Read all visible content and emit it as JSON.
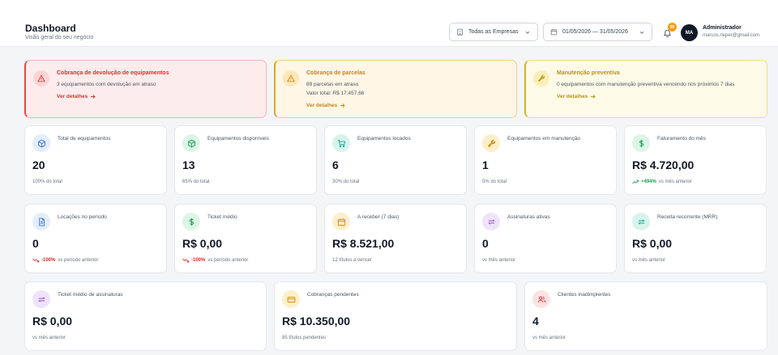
{
  "header": {
    "title": "Dashboard",
    "subtitle": "Visão geral do seu negócio",
    "company_filter": "Todas as Empresas",
    "date_range": "01/05/2026 — 31/05/2026",
    "notifications_count": "95",
    "user": {
      "initials": "MA",
      "name": "Administrador",
      "email": "marcos.rieper@gmail.com"
    }
  },
  "alerts": [
    {
      "title": "Cobrança de devolução de equipamentos",
      "lines": [
        "3 equipamentos com devolução em atraso"
      ],
      "link": "Ver detalhes",
      "icon": "warning-triangle-icon"
    },
    {
      "title": "Cobrança de parcelas",
      "lines": [
        "89 parcelas em atraso",
        "Valor total: R$ 17.457,66"
      ],
      "link": "Ver detalhes",
      "icon": "warning-triangle-icon"
    },
    {
      "title": "Manutenção preventiva",
      "lines": [
        "0 equipamentos com manutenção preventiva vencendo nos próximos 7 dias"
      ],
      "link": "Ver detalhes",
      "icon": "wrench-icon"
    }
  ],
  "row1": [
    {
      "label": "Total de equipamentos",
      "value": "20",
      "sub": "100% do total",
      "icon": "box-icon"
    },
    {
      "label": "Equipamentos disponíveis",
      "value": "13",
      "sub": "65% do total",
      "icon": "box-check-icon"
    },
    {
      "label": "Equipamentos locados",
      "value": "6",
      "sub": "30% do total",
      "icon": "cart-icon"
    },
    {
      "label": "Equipamentos em manutenção",
      "value": "1",
      "sub": "5% do total",
      "icon": "wrench-icon"
    },
    {
      "label": "Faturamento do mês",
      "value": "R$ 4.720,00",
      "trend": "+494%",
      "sub": "vs mês anterior",
      "icon": "dollar-icon"
    }
  ],
  "row2": [
    {
      "label": "Locações no período",
      "value": "0",
      "trend": "-100%",
      "sub": "vs período anterior",
      "icon": "document-icon"
    },
    {
      "label": "Ticket médio",
      "value": "R$ 0,00",
      "trend": "-100%",
      "sub": "vs período anterior",
      "icon": "dollar-icon"
    },
    {
      "label": "A receber (7 dias)",
      "value": "R$ 8.521,00",
      "sub": "12 títulos a vencer",
      "icon": "calendar-icon"
    },
    {
      "label": "Assinaturas ativas",
      "value": "0",
      "sub": "vs mês anterior",
      "icon": "repeat-icon"
    },
    {
      "label": "Receita recorrente (MRR)",
      "value": "R$ 0,00",
      "sub": "vs mês anterior",
      "icon": "repeat-icon"
    }
  ],
  "row3": [
    {
      "label": "Ticket médio de assinaturas",
      "value": "R$ 0,00",
      "sub": "vs mês anterior",
      "icon": "repeat-icon"
    },
    {
      "label": "Cobranças pendentes",
      "value": "R$ 10.350,00",
      "sub": "85 títulos pendentes",
      "icon": "credit-card-icon"
    },
    {
      "label": "Clientes inadimplentes",
      "value": "4",
      "sub": "vs mês anterior",
      "icon": "users-icon"
    }
  ],
  "colors": {
    "positive": "#16a34a",
    "negative": "#dc2626",
    "alert_red": "#d93030",
    "alert_orange": "#c98512",
    "alert_yellow": "#b59312"
  }
}
